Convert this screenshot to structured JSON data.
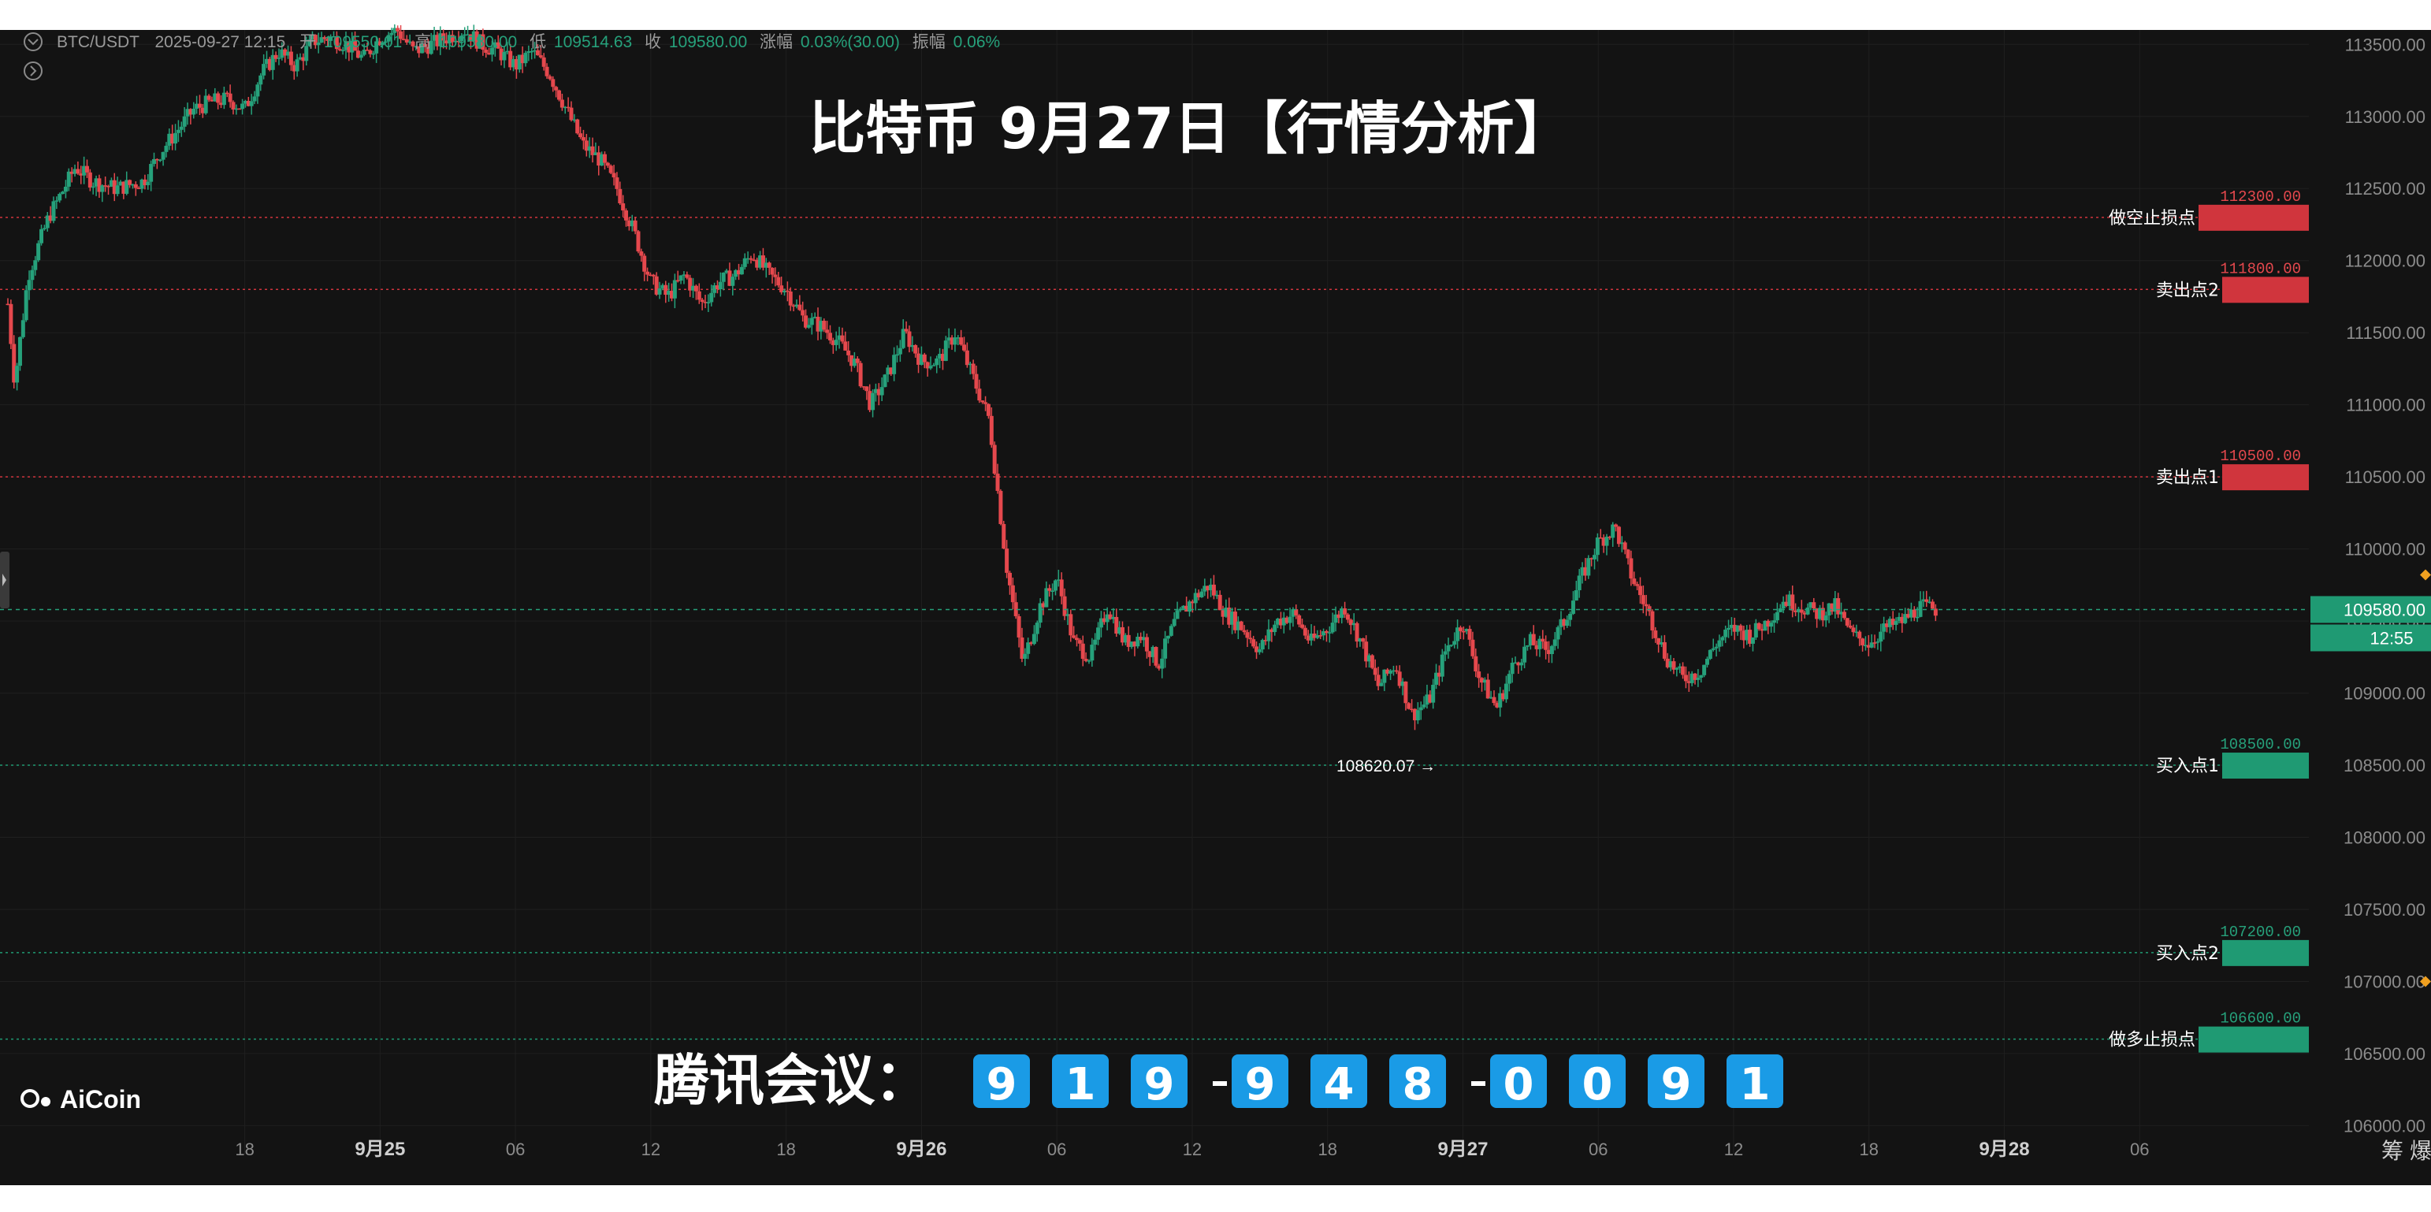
{
  "ohlc_header": {
    "symbol": "BTC/USDT",
    "datetime": "2025-09-27 12:15",
    "open_label": "开",
    "open": "109550.01",
    "high_label": "高",
    "high": "109580.00",
    "low_label": "低",
    "low": "109514.63",
    "close_label": "收",
    "close": "109580.00",
    "change_label": "涨幅",
    "change": "0.03%(30.00)",
    "amplitude_label": "振幅",
    "amplitude": "0.06%"
  },
  "banner_title": "比特币 9月27日【行情分析】",
  "meeting": {
    "label": "腾讯会议：",
    "digits": [
      "9",
      "1",
      "9",
      "-",
      "9",
      "4",
      "8",
      "-",
      "0",
      "0",
      "9",
      "1"
    ]
  },
  "logo_text": "AiCoin",
  "low_marker": "108620.07 →",
  "bottom_icons": [
    "筹",
    "爆"
  ],
  "colors": {
    "background": "#131313",
    "up": "#26a17b",
    "down": "#e5484d",
    "level_red": "#d0353d",
    "level_green": "#1f9a73",
    "badge_blue": "#1a9be6"
  },
  "chart_data": {
    "type": "candlestick",
    "symbol": "BTC/USDT",
    "interval": "15m",
    "ylim": [
      105800,
      113600
    ],
    "y_ticks": [
      106000,
      106500,
      107000,
      107500,
      108000,
      108500,
      109000,
      109500,
      110000,
      110500,
      111000,
      111500,
      112000,
      112500,
      113000,
      113500
    ],
    "x_labels": [
      "18",
      "9月25",
      "06",
      "12",
      "18",
      "9月26",
      "06",
      "12",
      "18",
      "9月27",
      "06",
      "12",
      "18",
      "9月28",
      "06"
    ],
    "x_label_positions": [
      8,
      12,
      16,
      20,
      24,
      28,
      32,
      36,
      40,
      44,
      48,
      52,
      56,
      60,
      64
    ],
    "x_range": [
      1,
      69
    ],
    "current_price": 109580.0,
    "countdown": "12:55",
    "session_low": 108620.07,
    "path": [
      [
        1,
        111700
      ],
      [
        1.2,
        111150
      ],
      [
        1.6,
        111900
      ],
      [
        2.2,
        112300
      ],
      [
        3.0,
        112650
      ],
      [
        3.5,
        112550
      ],
      [
        4.2,
        112500
      ],
      [
        5.0,
        112550
      ],
      [
        5.5,
        112750
      ],
      [
        6.0,
        112900
      ],
      [
        6.5,
        113050
      ],
      [
        7.0,
        113100
      ],
      [
        7.5,
        113120
      ],
      [
        8.0,
        113050
      ],
      [
        8.5,
        113300
      ],
      [
        9.0,
        113450
      ],
      [
        9.5,
        113350
      ],
      [
        10.0,
        113520
      ],
      [
        10.5,
        113550
      ],
      [
        11.0,
        113500
      ],
      [
        11.5,
        113400
      ],
      [
        12.0,
        113550
      ],
      [
        12.5,
        113600
      ],
      [
        13.0,
        113450
      ],
      [
        13.5,
        113500
      ],
      [
        14.0,
        113550
      ],
      [
        14.5,
        113600
      ],
      [
        15.0,
        113500
      ],
      [
        15.5,
        113450
      ],
      [
        16.0,
        113350
      ],
      [
        16.5,
        113450
      ],
      [
        17.0,
        113300
      ],
      [
        17.5,
        113050
      ],
      [
        18.0,
        112800
      ],
      [
        18.5,
        112700
      ],
      [
        19.0,
        112500
      ],
      [
        19.5,
        112200
      ],
      [
        20.0,
        111850
      ],
      [
        20.5,
        111750
      ],
      [
        21.0,
        111900
      ],
      [
        21.5,
        111700
      ],
      [
        22.0,
        111850
      ],
      [
        22.5,
        111900
      ],
      [
        23.0,
        112050
      ],
      [
        23.5,
        111900
      ],
      [
        24.0,
        111800
      ],
      [
        24.5,
        111600
      ],
      [
        25.0,
        111550
      ],
      [
        25.5,
        111450
      ],
      [
        26.0,
        111300
      ],
      [
        26.5,
        111000
      ],
      [
        27.0,
        111200
      ],
      [
        27.5,
        111500
      ],
      [
        28.0,
        111300
      ],
      [
        28.5,
        111300
      ],
      [
        29.0,
        111500
      ],
      [
        29.5,
        111200
      ],
      [
        30.0,
        110900
      ],
      [
        30.5,
        109900
      ],
      [
        31.0,
        109200
      ],
      [
        31.5,
        109600
      ],
      [
        32.0,
        109800
      ],
      [
        32.5,
        109350
      ],
      [
        33.0,
        109250
      ],
      [
        33.5,
        109600
      ],
      [
        34.0,
        109350
      ],
      [
        34.5,
        109400
      ],
      [
        35.0,
        109200
      ],
      [
        35.5,
        109500
      ],
      [
        36.0,
        109650
      ],
      [
        36.5,
        109750
      ],
      [
        37.0,
        109550
      ],
      [
        37.5,
        109450
      ],
      [
        38.0,
        109300
      ],
      [
        38.5,
        109500
      ],
      [
        39.0,
        109550
      ],
      [
        39.5,
        109350
      ],
      [
        40.0,
        109450
      ],
      [
        40.5,
        109600
      ],
      [
        41.0,
        109350
      ],
      [
        41.5,
        109050
      ],
      [
        42.0,
        109200
      ],
      [
        42.5,
        108850
      ],
      [
        43.0,
        108950
      ],
      [
        43.5,
        109300
      ],
      [
        44.0,
        109500
      ],
      [
        44.5,
        109100
      ],
      [
        45.0,
        108900
      ],
      [
        45.5,
        109200
      ],
      [
        46.0,
        109350
      ],
      [
        46.5,
        109300
      ],
      [
        47.0,
        109500
      ],
      [
        47.5,
        109800
      ],
      [
        48.0,
        110050
      ],
      [
        48.5,
        110150
      ],
      [
        49.0,
        109800
      ],
      [
        49.5,
        109550
      ],
      [
        50.0,
        109250
      ],
      [
        50.5,
        109100
      ],
      [
        51.0,
        109150
      ],
      [
        51.5,
        109350
      ],
      [
        52.0,
        109450
      ],
      [
        52.5,
        109400
      ],
      [
        53.0,
        109500
      ],
      [
        53.5,
        109650
      ],
      [
        54.0,
        109600
      ],
      [
        54.5,
        109550
      ],
      [
        55.0,
        109600
      ],
      [
        55.5,
        109400
      ],
      [
        56.0,
        109350
      ],
      [
        56.5,
        109450
      ],
      [
        57.0,
        109500
      ],
      [
        57.5,
        109600
      ],
      [
        58.0,
        109580
      ]
    ],
    "horizontal_levels": [
      {
        "label": "做空止损点",
        "value": "112300.00",
        "price": 112300,
        "kind": "red"
      },
      {
        "label": "卖出点2",
        "value": "111800.00",
        "price": 111800,
        "kind": "red"
      },
      {
        "label": "卖出点1",
        "value": "110500.00",
        "price": 110500,
        "kind": "red"
      },
      {
        "label": "买入点1",
        "value": "108500.00",
        "price": 108500,
        "kind": "green"
      },
      {
        "label": "买入点2",
        "value": "107200.00",
        "price": 107200,
        "kind": "green"
      },
      {
        "label": "做多止损点",
        "value": "106600.00",
        "price": 106600,
        "kind": "green"
      }
    ]
  }
}
